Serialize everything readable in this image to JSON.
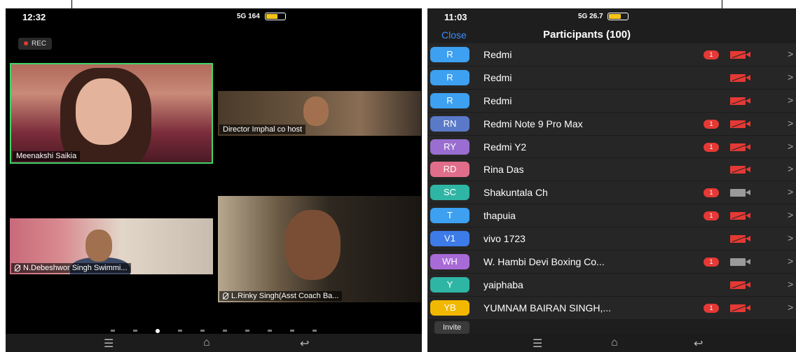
{
  "left": {
    "status_time": "12:32",
    "status_icons": "5G 164",
    "rec_label": "REC",
    "tiles": [
      {
        "caption": "Meenakshi Saikia"
      },
      {
        "caption": "Director Imphal co host"
      },
      {
        "caption": "N.Debeshwor Singh Swimmi..."
      },
      {
        "caption": "L.Rinky Singh(Asst Coach Ba..."
      }
    ],
    "page_dots": 10,
    "active_dot": 2
  },
  "right": {
    "status_time": "11:03",
    "status_icons": "5G 26.7",
    "close_label": "Close",
    "title": "Participants (100)",
    "participants": [
      {
        "initials": "R",
        "name": "Redmi",
        "color": "#3da0f0",
        "badge": "1",
        "video": "off"
      },
      {
        "initials": "R",
        "name": "Redmi",
        "color": "#3da0f0",
        "badge": "",
        "video": "off"
      },
      {
        "initials": "R",
        "name": "Redmi",
        "color": "#3da0f0",
        "badge": "",
        "video": "off"
      },
      {
        "initials": "RN",
        "name": "Redmi Note 9 Pro Max",
        "color": "#5b79c9",
        "badge": "1",
        "video": "off"
      },
      {
        "initials": "RY",
        "name": "Redmi Y2",
        "color": "#9a6ed0",
        "badge": "1",
        "video": "off"
      },
      {
        "initials": "RD",
        "name": "Rina Das",
        "color": "#e06e8a",
        "badge": "",
        "video": "off"
      },
      {
        "initials": "SC",
        "name": "Shakuntala Ch",
        "color": "#2fb5a4",
        "badge": "1",
        "video": "on"
      },
      {
        "initials": "T",
        "name": "thapuia",
        "color": "#3da0f0",
        "badge": "1",
        "video": "off"
      },
      {
        "initials": "V1",
        "name": "vivo 1723",
        "color": "#3d7be8",
        "badge": "",
        "video": "off"
      },
      {
        "initials": "WH",
        "name": "W. Hambi Devi Boxing Co...",
        "color": "#a86ad6",
        "badge": "1",
        "video": "on"
      },
      {
        "initials": "Y",
        "name": "yaiphaba",
        "color": "#2fb5a4",
        "badge": "",
        "video": "off"
      },
      {
        "initials": "YB",
        "name": "YUMNAM BAIRAN SINGH,...",
        "color": "#f2b800",
        "badge": "1",
        "video": "off"
      }
    ],
    "invite_label": "Invite"
  }
}
